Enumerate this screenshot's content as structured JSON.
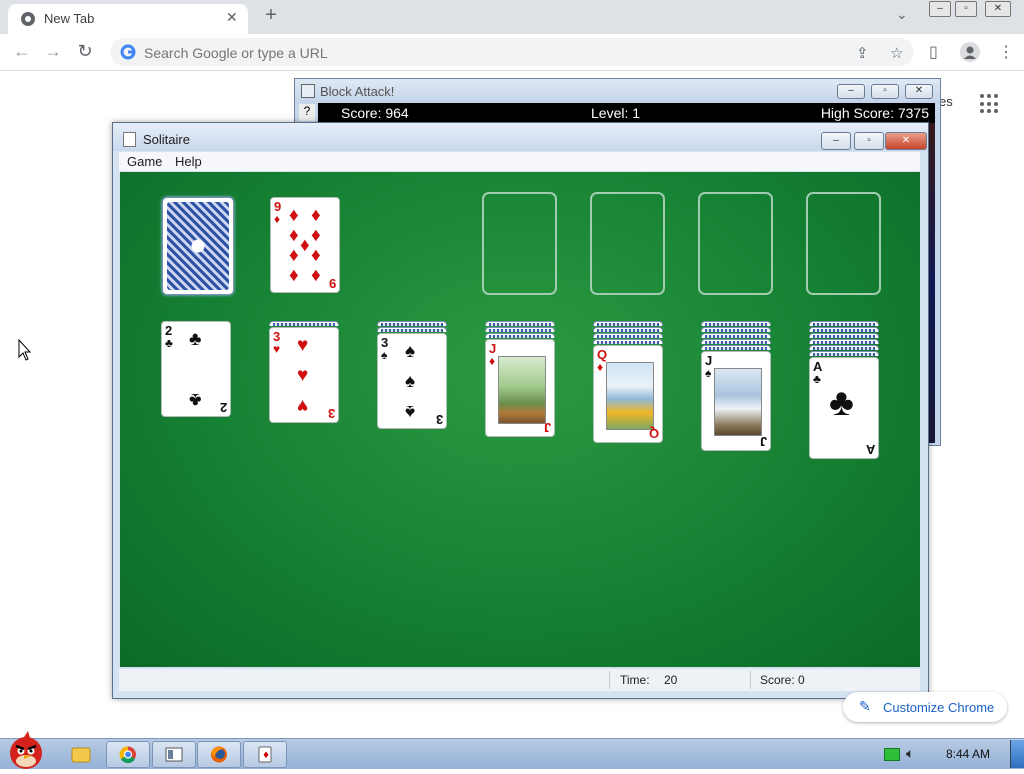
{
  "browser": {
    "tab_title": "New Tab",
    "address_placeholder": "Search Google or type a URL",
    "customize_label": "Customize Chrome",
    "ntp_trunc_text": "es"
  },
  "block_attack": {
    "title": "Block Attack!",
    "help": "?",
    "score": "Score: 964",
    "level": "Level: 1",
    "high_score": "High Score: 7375"
  },
  "solitaire": {
    "title": "Solitaire",
    "menu": [
      "Game",
      "Help"
    ],
    "status": {
      "time_label": "Time:",
      "time_value": "20",
      "score_label": "Score: 0"
    },
    "waste": {
      "rank": "9",
      "suit": "♦",
      "color": "red"
    },
    "tableau": [
      {
        "rank": "2",
        "suit": "♣",
        "color": "blk",
        "hidden": 0
      },
      {
        "rank": "3",
        "suit": "♥",
        "color": "red",
        "hidden": 1
      },
      {
        "rank": "3",
        "suit": "♠",
        "color": "blk",
        "hidden": 2
      },
      {
        "rank": "J",
        "suit": "♦",
        "color": "red",
        "hidden": 3
      },
      {
        "rank": "Q",
        "suit": "♦",
        "color": "red",
        "hidden": 4
      },
      {
        "rank": "J",
        "suit": "♠",
        "color": "blk",
        "hidden": 5
      },
      {
        "rank": "A",
        "suit": "♣",
        "color": "blk",
        "hidden": 6
      }
    ]
  },
  "taskbar": {
    "clock": "8:44 AM"
  },
  "colors": {
    "felt": "#158133",
    "accent": "#1a62c7"
  }
}
